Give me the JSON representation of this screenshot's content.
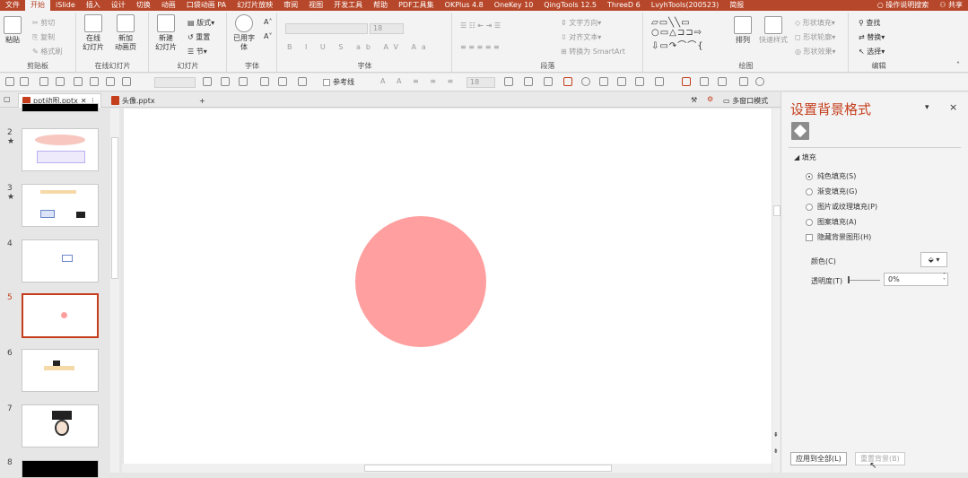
{
  "menubar": {
    "items": [
      "文件",
      "开始",
      "iSlide",
      "插入",
      "设计",
      "切换",
      "动画",
      "口袋动画 PA",
      "幻灯片放映",
      "审阅",
      "视图",
      "开发工具",
      "帮助",
      "PDF工具集",
      "OKPlus 4.8",
      "OneKey 10",
      "QingTools 12.5",
      "ThreeD 6",
      "LvyhTools(200523)",
      "简报"
    ],
    "active": "开始",
    "search": "操作说明搜索",
    "share": "共享"
  },
  "ribbon": {
    "clipboard": {
      "paste": "粘贴",
      "cut": "剪切",
      "copy": "复制",
      "format_painter": "格式刷",
      "label": "剪贴板"
    },
    "online_slides": {
      "online": "在线",
      "slides1": "幻灯片",
      "new_label": "新加",
      "animation_page": "动画页",
      "label": "在线幻灯片"
    },
    "slides": {
      "new": "新建",
      "slide": "幻灯片",
      "layout": "版式",
      "reset": "重置",
      "section": "节",
      "label": "幻灯片"
    },
    "font_group": {
      "used": "已用字",
      "body": "体",
      "label": "字体"
    },
    "font": {
      "size": "18",
      "label": "字体"
    },
    "paragraph": {
      "text_dir": "文字方向",
      "align_text": "对齐文本",
      "smartart": "转换为 SmartArt",
      "label": "段落"
    },
    "drawing": {
      "arrange": "排列",
      "quick_styles": "快速样式",
      "shape_fill": "形状填充",
      "shape_outline": "形状轮廓",
      "shape_effects": "形状效果",
      "label": "绘图"
    },
    "editing": {
      "find": "查找",
      "replace": "替换",
      "select": "选择",
      "label": "编辑"
    }
  },
  "qat": {
    "reference_line": "参考线",
    "size": "18"
  },
  "file_tabs": [
    {
      "label": "ppt动图.pptx",
      "active": true
    },
    {
      "label": "头像.pptx",
      "active": false
    }
  ],
  "multi_window": "多窗口模式",
  "thumbnails": [
    {
      "num": "2",
      "star": "★"
    },
    {
      "num": "3",
      "star": "★"
    },
    {
      "num": "4",
      "star": ""
    },
    {
      "num": "5",
      "star": ""
    },
    {
      "num": "6",
      "star": ""
    },
    {
      "num": "7",
      "star": ""
    },
    {
      "num": "8",
      "star": ""
    }
  ],
  "selected_slide": "5",
  "panel": {
    "title": "设置背景格式",
    "section": "填充",
    "options": [
      "纯色填充(S)",
      "渐变填充(G)",
      "图片或纹理填充(P)",
      "图案填充(A)"
    ],
    "selected_option": "纯色填充(S)",
    "hide_bg": "隐藏背景图形(H)",
    "color_label": "颜色(C)",
    "transparency_label": "透明度(T)",
    "transparency_value": "0%",
    "apply_all": "应用到全部(L)",
    "reset_bg": "重置背景(B)"
  },
  "colors": {
    "accent": "#b7472a",
    "circle": "#ff9f9f"
  }
}
